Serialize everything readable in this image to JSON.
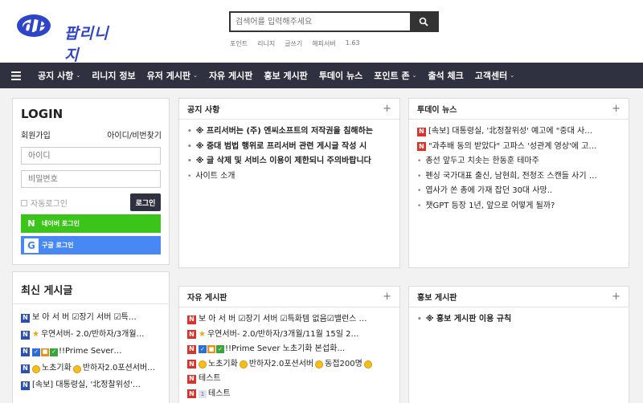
{
  "header": {
    "logo_text": "팝리니지",
    "logo_mark": "dP",
    "search_placeholder": "검색어를 입력해주세요",
    "quick_links": [
      "포인트",
      "리니지",
      "글쓰기",
      "해피서버",
      "1.63"
    ]
  },
  "nav": {
    "items": [
      {
        "label": "공지 사항",
        "caret": true
      },
      {
        "label": "리니지 정보",
        "caret": false
      },
      {
        "label": "유저 게시판",
        "caret": true
      },
      {
        "label": "자유 게시판",
        "caret": false
      },
      {
        "label": "홍보 게시판",
        "caret": false
      },
      {
        "label": "투데이 뉴스",
        "caret": false
      },
      {
        "label": "포인트 존",
        "caret": true
      },
      {
        "label": "출석 체크",
        "caret": false
      },
      {
        "label": "고객센터",
        "caret": true
      }
    ]
  },
  "login": {
    "title": "LOGIN",
    "signup": "회원가입",
    "find": "아이디/비번찾기",
    "id_placeholder": "아이디",
    "pw_placeholder": "비밀번호",
    "auto_login": "자동로그인",
    "login_button": "로그인",
    "naver_mark": "N",
    "naver_label": "네이버 로그인",
    "google_mark": "G",
    "google_label": "구글 로그인"
  },
  "recent": {
    "title": "최신 게시글",
    "items": [
      "보 아 서 버 ☑장기 서버 ☑특…",
      "우연서버- 2.0/반하자/3개월…",
      "!!Prime Sever…",
      "노초기화",
      "반하자2.0포션서버…",
      "[속보] 대통령실, '北정찰위성'…"
    ]
  },
  "notice": {
    "title": "공지 사항",
    "items": [
      "※ 프리서버는 (주) 엔씨소프트의 저작권을 침해하는",
      "※ 중대 범법 행위로 프리서버 관련 게시글 작성 시",
      "※ 글 삭제 및 서비스 이용이 제한되니 주의바랍니다",
      "사이트 소개"
    ]
  },
  "today": {
    "title": "투데이 뉴스",
    "items": [
      "[속보] 대통령실, '北정찰위성' 예고에 \"중대 사…",
      "\"과추배 동의 받았다\" 고파스 '성관계 영상'에 고…",
      "총선 앞두고 치솟는 한동훈 테마주",
      "펜싱 국가대표 출신, 남현희, 전청조 스캔들 사기 …",
      "엽사가 쏜 총에 가재 잡던 30대 사망..",
      "챗GPT 등장 1년, 앞으로 어떻게 될까?"
    ]
  },
  "free": {
    "title": "자유 게시판",
    "items": [
      "보 아 서 버 ☑장기 서버 ☑특화템 없음☑밸런스 …",
      "우연서버- 2.0/반하자/3개월/11월 15일 2…",
      "!!Prime Sever 노초기화 본섭화…",
      "노초기화",
      "반하자2.0포션서버",
      "동접200명",
      "테스트",
      "테스트"
    ]
  },
  "promo": {
    "title": "홍보 게시판",
    "items": [
      "※ 홍보 게시판 이용 규칙"
    ]
  },
  "badges": {
    "new": "N",
    "one": "1"
  },
  "colors": {
    "nav_bg": "#2f3140",
    "accent": "#2f45c8",
    "new_badge": "#d9342b",
    "naver": "#3bc51a",
    "google": "#4788f4"
  }
}
